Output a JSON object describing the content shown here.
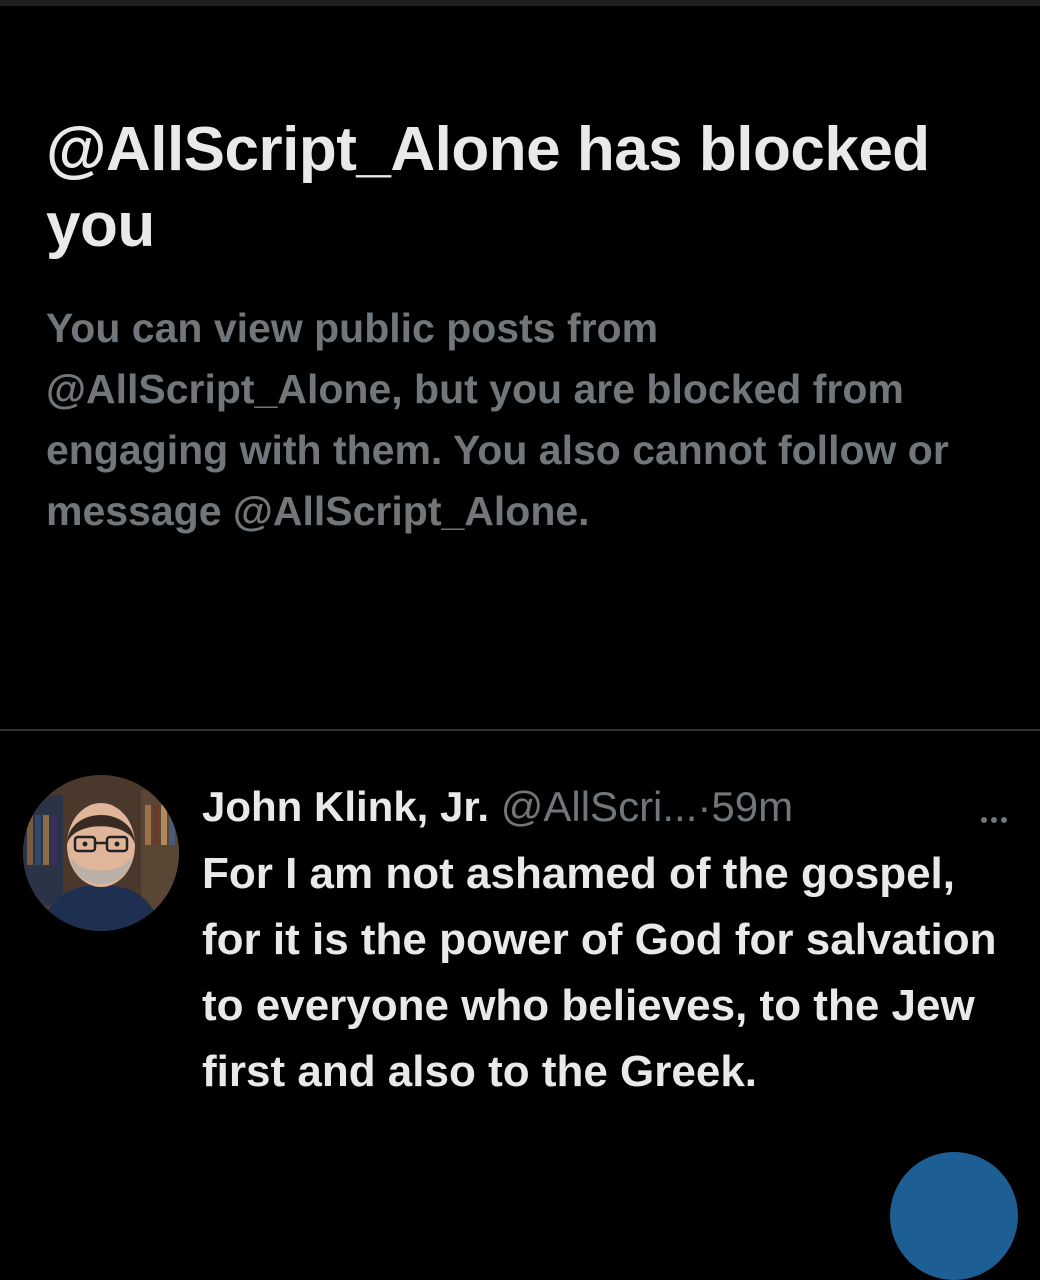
{
  "block_notice": {
    "title": "@AllScript_Alone has blocked you",
    "description": "You can view public posts from @AllScript_Alone, but you are blocked from engaging with them. You also cannot follow or message @AllScript_Alone."
  },
  "post": {
    "display_name": "John Klink, Jr.",
    "handle": "@AllScri...",
    "separator": "·",
    "timestamp": "59m",
    "text": "For I am not ashamed of the gospel, for it is the power of God for salvation to everyone who believes, to the Jew first and also to the Greek.",
    "avatar_icon": "profile-photo",
    "more_icon": "more-horizontal-icon"
  },
  "fab": {
    "icon": "compose-icon",
    "color": "#1d5f94"
  },
  "colors": {
    "background": "#000000",
    "primary_text": "#e7e9ea",
    "secondary_text": "#71767b",
    "divider": "#2f3336"
  }
}
